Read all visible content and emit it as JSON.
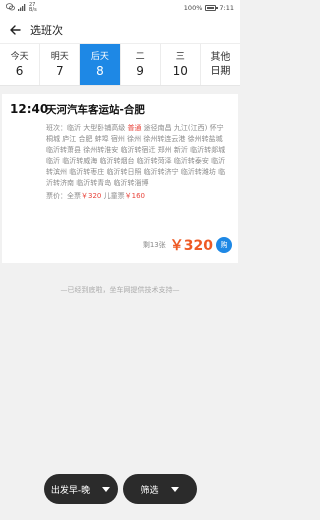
{
  "status": {
    "network_speed": "27",
    "network_unit": "B/s",
    "battery_percent": "100%",
    "time": "7:11"
  },
  "header": {
    "title": "选班次"
  },
  "date_tabs": [
    {
      "weekday": "今天",
      "day": "6"
    },
    {
      "weekday": "明天",
      "day": "7"
    },
    {
      "weekday": "后天",
      "day": "8",
      "active": true
    },
    {
      "weekday": "二",
      "day": "9"
    },
    {
      "weekday": "三",
      "day": "10"
    },
    {
      "weekday": "其他",
      "day": "日期"
    }
  ],
  "schedule": {
    "time": "12:40",
    "route": "天河汽车客运站-合肥",
    "detail_prefix": "班次：临沂 大型卧铺高级 ",
    "detail_highlight": "普通",
    "detail_suffix": " 途径南昌 九江(江西) 怀宁 桐城 庐江 合肥 蚌埠 宿州 徐州 徐州转连云港 徐州转盐城 临沂转萧县 徐州转淮安 临沂转宿迁 郑州 新沂 临沂转郯城 临沂 临沂转威海 临沂转烟台 临沂转菏泽 临沂转泰安 临沂转滨州 临沂转枣庄 临沂转日照 临沂转济宁 临沂转潍坊 临沂转济南 临沂转青岛 临沂转淄博",
    "fare_label": "票价：",
    "full_label": "全票",
    "full_price": "￥320",
    "child_label": "儿童票",
    "child_price": "￥160",
    "remaining": "剩13张",
    "price": "￥320",
    "buy_label": "购"
  },
  "end_text": "—已经到底啦，坐车网提供技术支持—",
  "bottom": {
    "depart_sort": "出发早-晚",
    "filter": "筛选"
  },
  "colors": {
    "accent": "#1e88e5",
    "price": "#ee5a24",
    "highlight": "#e8453c"
  }
}
